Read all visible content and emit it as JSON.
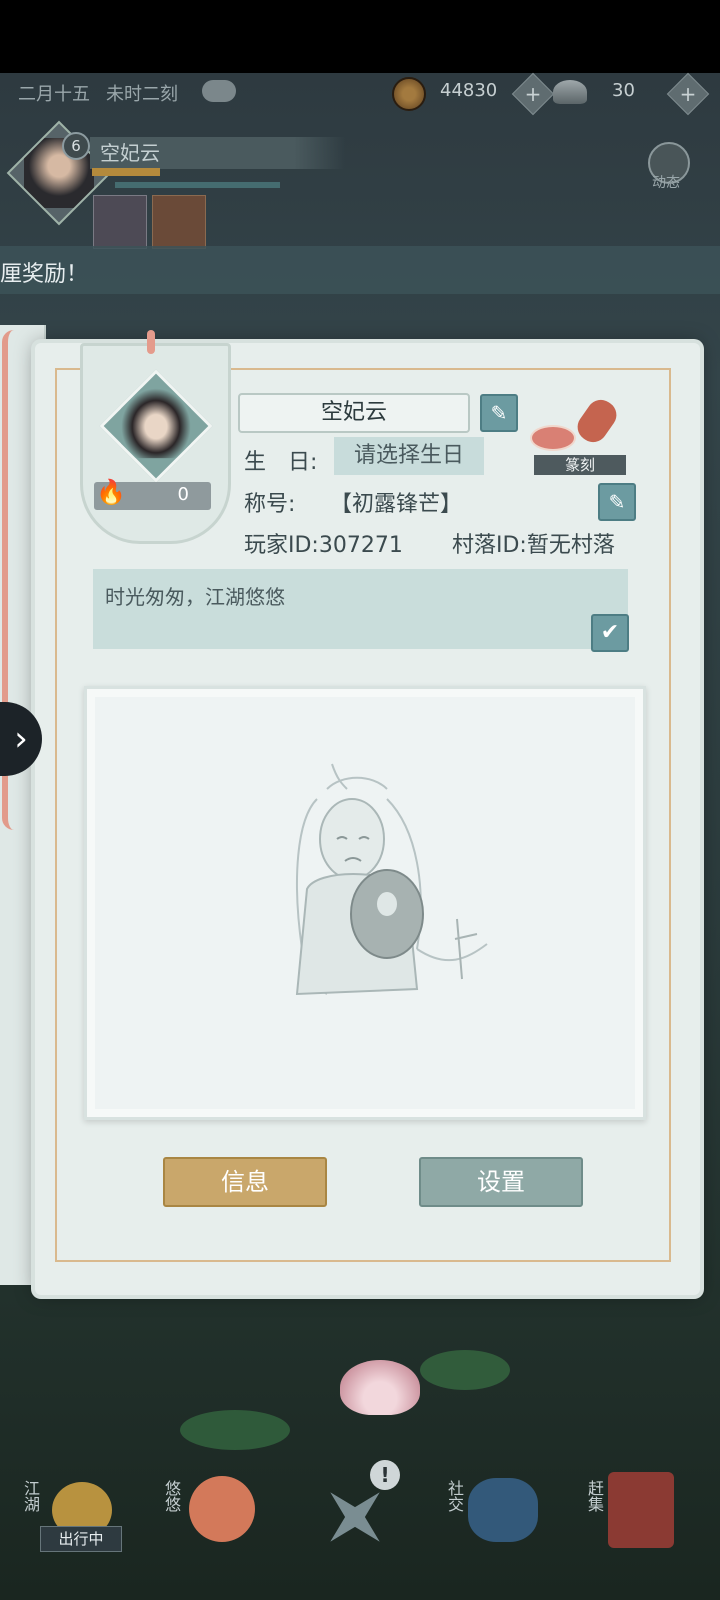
{
  "hud": {
    "date": "二月十五",
    "time": "未时二刻",
    "coins": "44830",
    "ingots": "30",
    "coin_icon": "copper-coin-icon",
    "ingot_icon": "silver-ingot-icon"
  },
  "player": {
    "level": "6",
    "name": "空妃云"
  },
  "side": {
    "activity_label": "动态"
  },
  "banner": {
    "text": "厘奖励！"
  },
  "profile": {
    "name": "空妃云",
    "fire_count": "0",
    "birthday_label": "生　日:",
    "birthday_placeholder": "请选择生日",
    "title_label": "称号:",
    "title_value": "【初露锋芒】",
    "player_id": "玩家ID:307271",
    "village_id": "村落ID:暂无村落",
    "signature": "时光匆匆，江湖悠悠",
    "seal_label": "篆刻"
  },
  "buttons": {
    "info": "信息",
    "settings": "设置"
  },
  "bottom_nav": [
    {
      "label": "江湖",
      "icon": "jianghu-icon"
    },
    {
      "label": "出行中",
      "icon": "travel-icon"
    },
    {
      "label": "悠悠",
      "icon": "youyou-icon"
    },
    {
      "label": "!",
      "icon": "star-compass-icon"
    },
    {
      "label": "社交",
      "icon": "social-icon"
    },
    {
      "label": "赶集",
      "icon": "market-icon"
    }
  ]
}
